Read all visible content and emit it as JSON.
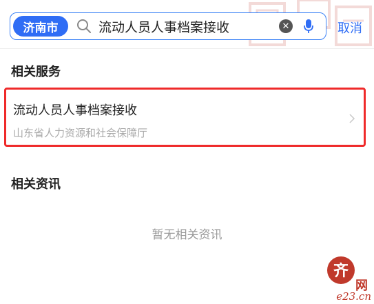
{
  "search": {
    "city": "济南市",
    "query": "流动人员人事档案接收",
    "cancel_label": "取消"
  },
  "services": {
    "title": "相关服务",
    "items": [
      {
        "title": "流动人员人事档案接收",
        "provider": "山东省人力资源和社会保障厅"
      }
    ]
  },
  "news": {
    "title": "相关资讯",
    "empty_text": "暂无相关资讯"
  },
  "watermark": {
    "text": "网",
    "url": "e23.cn"
  },
  "colors": {
    "accent": "#2f6df5",
    "highlight_border": "#ef2a2a",
    "watermark": "#c0392b"
  },
  "icons": {
    "search": "search-icon",
    "clear": "clear-icon",
    "mic": "microphone-icon",
    "chevron": "chevron-right-icon"
  }
}
